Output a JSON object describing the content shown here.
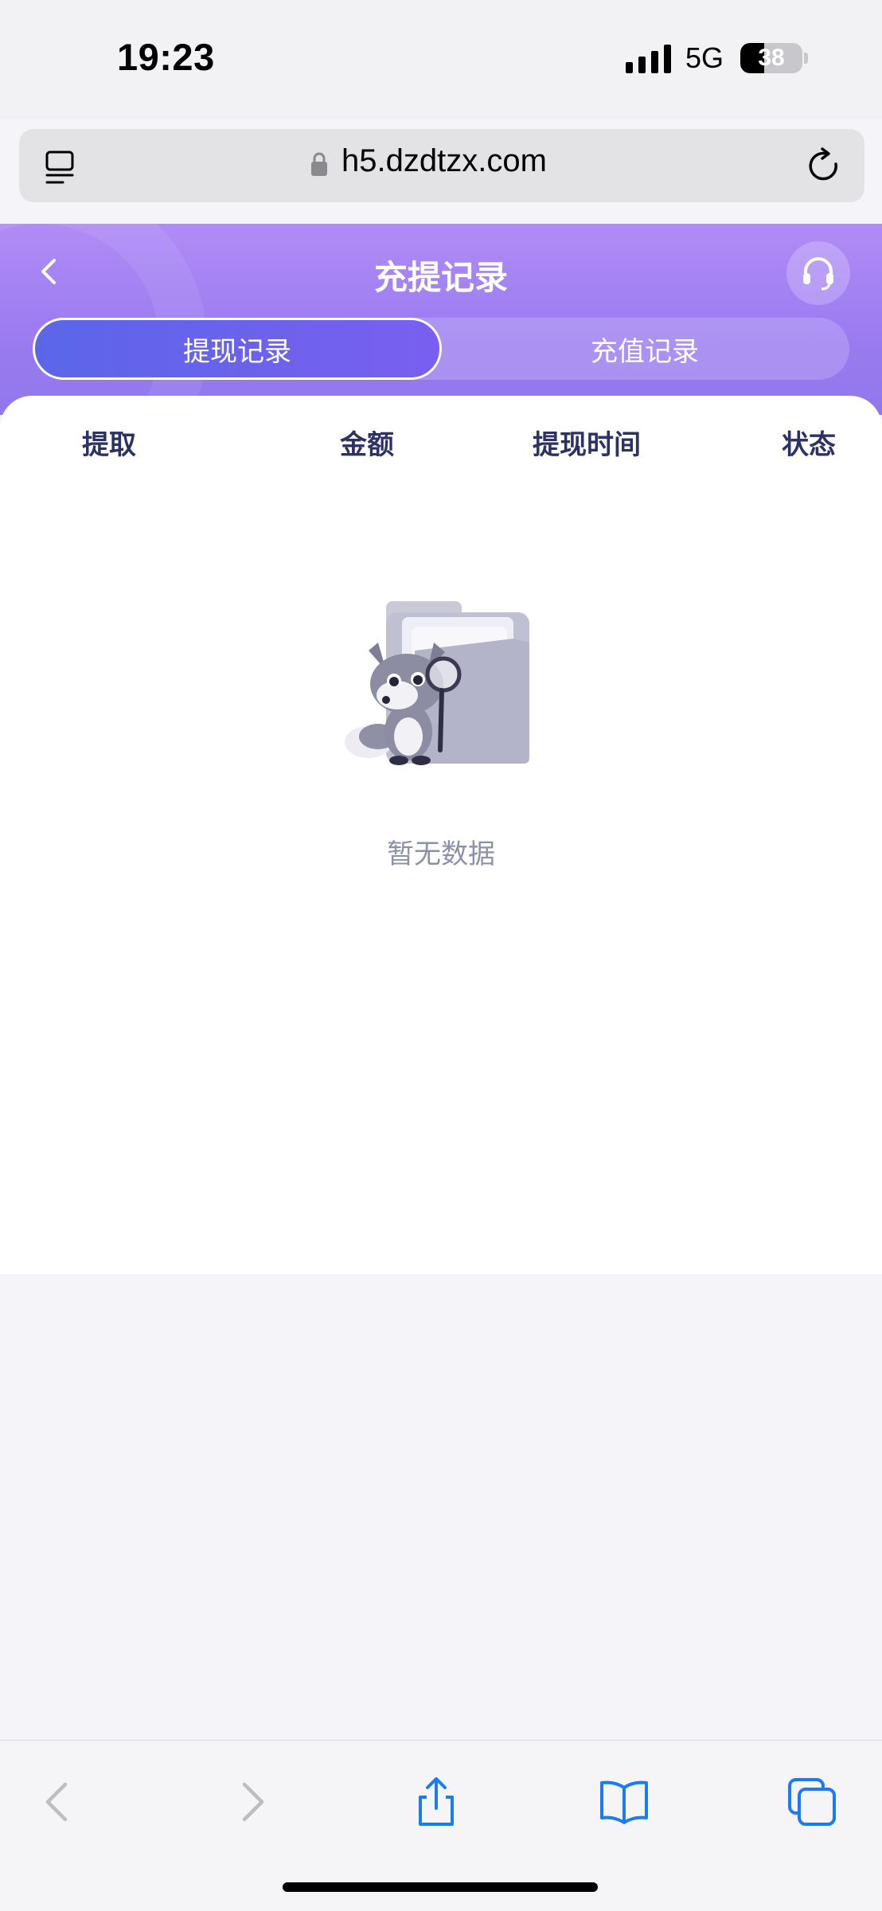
{
  "status_bar": {
    "time": "19:23",
    "network": "5G",
    "battery_level": "38",
    "battery_fraction": 0.38
  },
  "browser": {
    "url": "h5.dzdtzx.com"
  },
  "header": {
    "title": "充提记录",
    "tabs": [
      {
        "label": "提现记录",
        "active": true
      },
      {
        "label": "充值记录",
        "active": false
      }
    ]
  },
  "table": {
    "columns": [
      "提取",
      "金额",
      "提现时间",
      "状态"
    ]
  },
  "empty_state": {
    "message": "暂无数据"
  },
  "colors": {
    "header_gradient_top": "#b08cf6",
    "header_gradient_bottom": "#8f78ec",
    "active_tab_start": "#5a66e8",
    "active_tab_end": "#7a5ff0",
    "column_text": "#2d3266",
    "empty_text": "#8c90a8",
    "toolbar_blue": "#1a7cf5"
  },
  "icons": {
    "back": "chevron-left-icon",
    "support": "headset-icon",
    "reader": "reader-mode-icon",
    "lock": "lock-icon",
    "reload": "reload-icon",
    "toolbar": [
      "back-arrow-icon",
      "forward-arrow-icon",
      "share-icon",
      "bookmarks-icon",
      "tabs-icon"
    ]
  }
}
